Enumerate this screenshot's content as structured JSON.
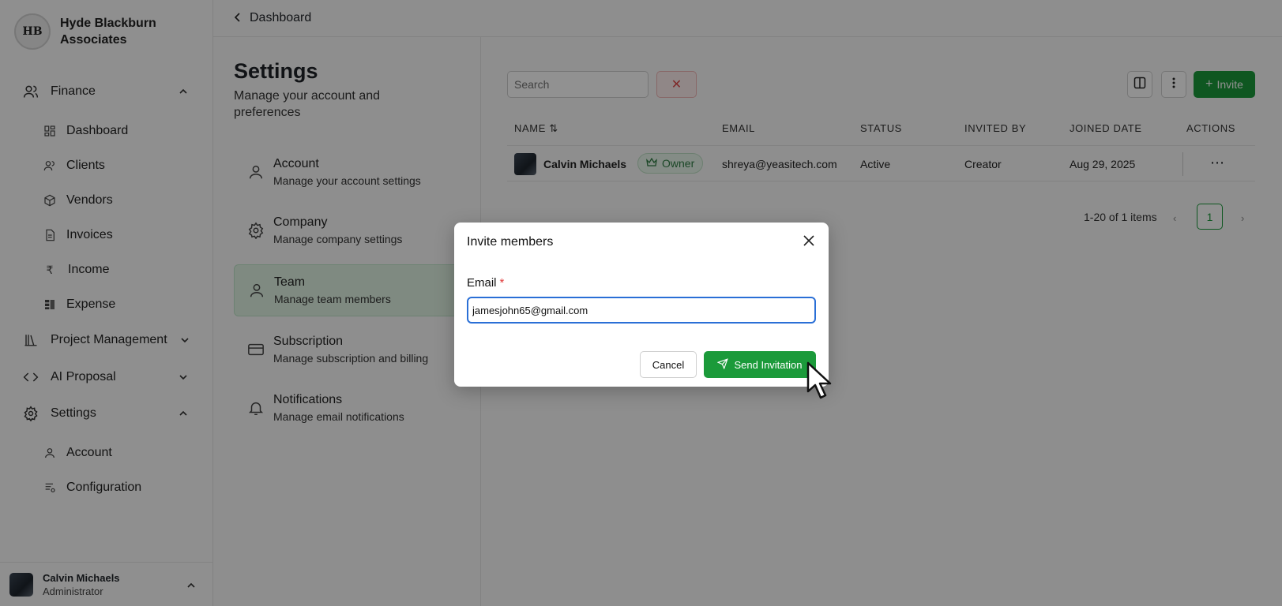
{
  "brand": {
    "logo_text": "HB",
    "name": "Hyde Blackburn Associates"
  },
  "topbar": {
    "back_label": "Dashboard"
  },
  "sidebar": {
    "groups": [
      {
        "label": "Finance",
        "icon": "users-icon",
        "expanded": true,
        "items": [
          {
            "label": "Dashboard",
            "icon": "grid-icon"
          },
          {
            "label": "Clients",
            "icon": "users-icon"
          },
          {
            "label": "Vendors",
            "icon": "box-icon"
          },
          {
            "label": "Invoices",
            "icon": "file-icon"
          },
          {
            "label": "Income",
            "icon": "rupee-icon"
          },
          {
            "label": "Expense",
            "icon": "table-icon"
          }
        ]
      },
      {
        "label": "Project Management",
        "icon": "library-icon",
        "expanded": false
      },
      {
        "label": "AI Proposal",
        "icon": "code-icon",
        "expanded": false
      },
      {
        "label": "Settings",
        "icon": "gear-icon",
        "expanded": true,
        "items": [
          {
            "label": "Account",
            "icon": "user-icon"
          },
          {
            "label": "Configuration",
            "icon": "config-icon"
          }
        ]
      }
    ],
    "user": {
      "name": "Calvin Michaels",
      "role": "Administrator"
    }
  },
  "settings": {
    "title": "Settings",
    "subtitle": "Manage your account and preferences",
    "items": [
      {
        "title": "Account",
        "desc": "Manage your account settings",
        "icon": "user-icon"
      },
      {
        "title": "Company",
        "desc": "Manage company settings",
        "icon": "gear-icon"
      },
      {
        "title": "Team",
        "desc": "Manage team members",
        "icon": "user-icon",
        "active": true
      },
      {
        "title": "Subscription",
        "desc": "Manage subscription and billing",
        "icon": "card-icon"
      },
      {
        "title": "Notifications",
        "desc": "Manage email notifications",
        "icon": "bell-icon"
      }
    ]
  },
  "team": {
    "search_placeholder": "Search",
    "invite_label": "Invite",
    "columns": [
      "NAME",
      "EMAIL",
      "STATUS",
      "INVITED BY",
      "JOINED DATE",
      "ACTIONS"
    ],
    "rows": [
      {
        "name": "Calvin Michaels",
        "badge": "Owner",
        "email": "shreya@yeasitech.com",
        "status": "Active",
        "invited_by": "Creator",
        "joined": "Aug 29, 2025"
      }
    ],
    "pagination": {
      "info": "1-20 of 1 items",
      "page": "1"
    }
  },
  "modal": {
    "title": "Invite members",
    "email_label": "Email",
    "required_mark": "*",
    "email_value": "jamesjohn65@gmail.com",
    "cancel_label": "Cancel",
    "send_label": "Send Invitation"
  },
  "colors": {
    "accent": "#1b9a3a",
    "focus": "#2a6fd6",
    "danger": "#e04848"
  }
}
